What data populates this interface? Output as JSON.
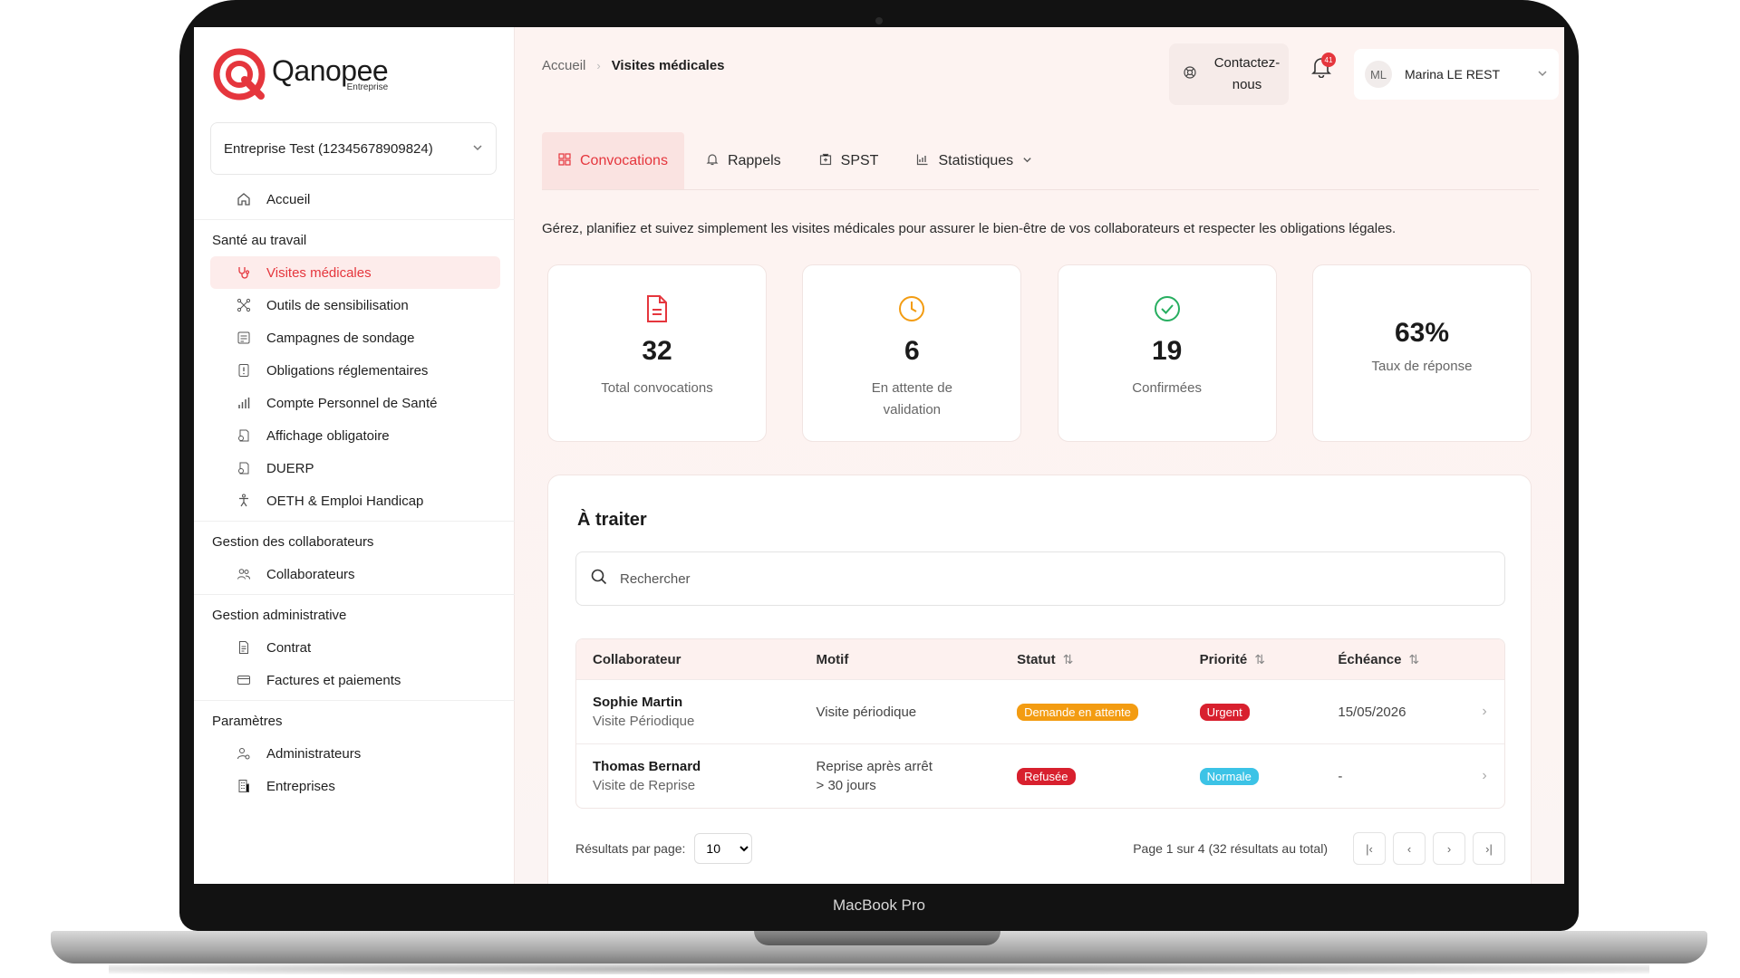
{
  "device": {
    "model_label": "MacBook Pro"
  },
  "logo": {
    "name": "Qanopee",
    "subtitle": "Entreprise"
  },
  "company_selector": {
    "value": "Entreprise Test (12345678909824)"
  },
  "sidebar": {
    "home": "Accueil",
    "sections": [
      {
        "title": "Santé au travail",
        "items": [
          "Visites médicales",
          "Outils de sensibilisation",
          "Campagnes de sondage",
          "Obligations réglementaires",
          "Compte Personnel de Santé",
          "Affichage obligatoire",
          "DUERP",
          "OETH & Emploi Handicap"
        ]
      },
      {
        "title": "Gestion des collaborateurs",
        "items": [
          "Collaborateurs"
        ]
      },
      {
        "title": "Gestion administrative",
        "items": [
          "Contrat",
          "Factures et paiements"
        ]
      },
      {
        "title": "Paramètres",
        "items": [
          "Administrateurs",
          "Entreprises"
        ]
      }
    ]
  },
  "breadcrumb": {
    "root": "Accueil",
    "current": "Visites médicales"
  },
  "header": {
    "contact_label": "Contactez-nous",
    "notifications_count": "41",
    "user_initials": "ML",
    "user_name": "Marina LE REST"
  },
  "tabs": [
    "Convocations",
    "Rappels",
    "SPST",
    "Statistiques"
  ],
  "intro": "Gérez, planifiez et suivez simplement les visites médicales pour assurer le bien-être de vos collaborateurs et respecter les obligations légales.",
  "stats": [
    {
      "value": "32",
      "label": "Total convocations",
      "icon": "document-icon"
    },
    {
      "value": "6",
      "label": "En attente de validation",
      "icon": "clock-icon"
    },
    {
      "value": "19",
      "label": "Confirmées",
      "icon": "check-circle-icon"
    },
    {
      "value": "63%",
      "label": "Taux de réponse"
    }
  ],
  "todo": {
    "title": "À traiter",
    "search_placeholder": "Rechercher",
    "columns": [
      "Collaborateur",
      "Motif",
      "Statut",
      "Priorité",
      "Échéance"
    ],
    "rows": [
      {
        "name": "Sophie Martin",
        "visit_type": "Visite Périodique",
        "motif": "Visite périodique",
        "status": "Demande en attente",
        "priority": "Urgent",
        "deadline": "15/05/2026"
      },
      {
        "name": "Thomas Bernard",
        "visit_type": "Visite de Reprise",
        "motif_line1": "Reprise après arrêt",
        "motif_line2": "> 30 jours",
        "status": "Refusée",
        "priority": "Normale",
        "deadline": "-"
      }
    ],
    "per_page_label": "Résultats par page:",
    "per_page_value": "10",
    "page_info": "Page 1 sur 4 (32 résultats au total)"
  },
  "colors": {
    "brand": "#e5363d",
    "pending": "#f39c12",
    "urgent": "#d8202e",
    "normal": "#3cc3e6"
  }
}
